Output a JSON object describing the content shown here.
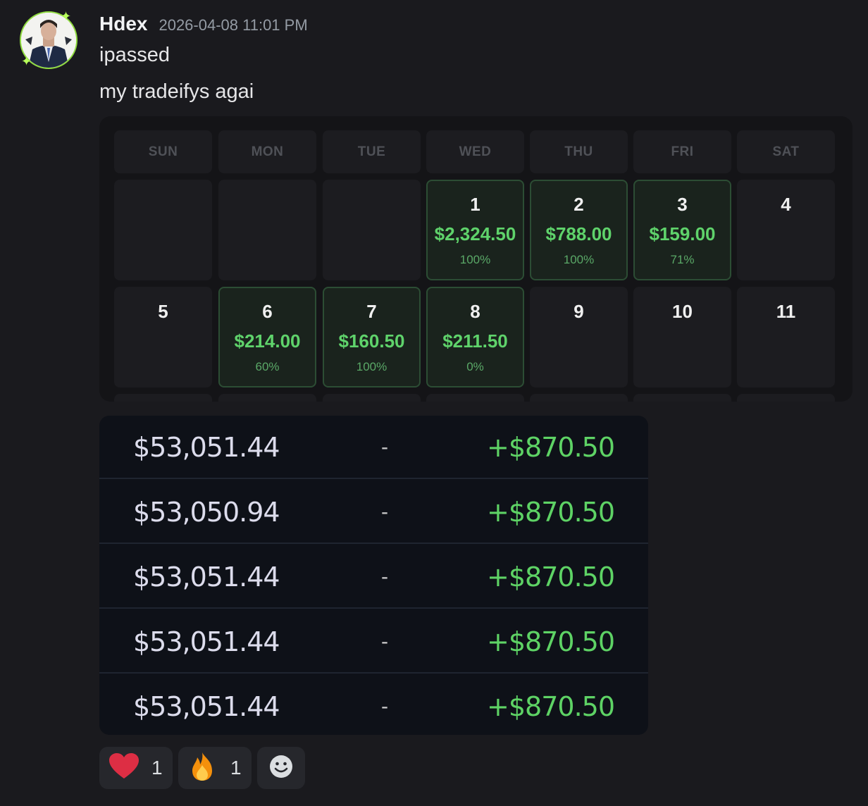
{
  "message": {
    "username": "Hdex",
    "timestamp": "2026-04-08 11:01 PM",
    "lines": [
      "ipassed",
      "my tradeifys agai"
    ]
  },
  "calendar": {
    "weekdays": [
      "SUN",
      "MON",
      "TUE",
      "WED",
      "THU",
      "FRI",
      "SAT"
    ],
    "weeks": [
      [
        {
          "day": "",
          "amount": "",
          "pct": ""
        },
        {
          "day": "",
          "amount": "",
          "pct": ""
        },
        {
          "day": "",
          "amount": "",
          "pct": ""
        },
        {
          "day": "1",
          "amount": "$2,324.50",
          "pct": "100%"
        },
        {
          "day": "2",
          "amount": "$788.00",
          "pct": "100%"
        },
        {
          "day": "3",
          "amount": "$159.00",
          "pct": "71%"
        },
        {
          "day": "4",
          "amount": "",
          "pct": ""
        }
      ],
      [
        {
          "day": "5",
          "amount": "",
          "pct": ""
        },
        {
          "day": "6",
          "amount": "$214.00",
          "pct": "60%"
        },
        {
          "day": "7",
          "amount": "$160.50",
          "pct": "100%"
        },
        {
          "day": "8",
          "amount": "$211.50",
          "pct": "0%"
        },
        {
          "day": "9",
          "amount": "",
          "pct": ""
        },
        {
          "day": "10",
          "amount": "",
          "pct": ""
        },
        {
          "day": "11",
          "amount": "",
          "pct": ""
        }
      ]
    ]
  },
  "accounts": [
    {
      "balance": "$53,051.44",
      "dash": "-",
      "gain": "+$870.50"
    },
    {
      "balance": "$53,050.94",
      "dash": "-",
      "gain": "+$870.50"
    },
    {
      "balance": "$53,051.44",
      "dash": "-",
      "gain": "+$870.50"
    },
    {
      "balance": "$53,051.44",
      "dash": "-",
      "gain": "+$870.50"
    },
    {
      "balance": "$53,051.44",
      "dash": "-",
      "gain": "+$870.50"
    }
  ],
  "reactions": [
    {
      "icon": "heart-icon",
      "count": "1"
    },
    {
      "icon": "fire-icon",
      "count": "1"
    },
    {
      "icon": "add-reaction-icon",
      "count": ""
    }
  ],
  "colors": {
    "background": "#1a1a1e",
    "profit_green": "#5ed365",
    "active_cell": "#1a231d",
    "table_bg": "#0e1118"
  }
}
